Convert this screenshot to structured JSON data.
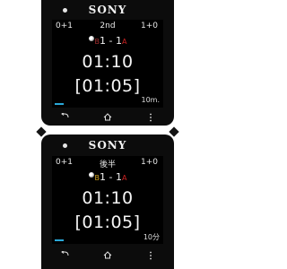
{
  "watches": [
    {
      "brand": "SONY",
      "score_left": "0+1",
      "period": "2nd",
      "score_right": "1+0",
      "team_left": "B",
      "team_left_score": "1",
      "separator": "-",
      "team_right_score": "1",
      "team_right": "A",
      "clock": "01:10",
      "clock_period": "[01:05]",
      "period_length": "10m.",
      "progress_percent": 12
    },
    {
      "brand": "SONY",
      "score_left": "0+1",
      "period": "後半",
      "score_right": "1+0",
      "team_left": "B",
      "team_left_score": "1",
      "separator": "-",
      "team_right_score": "1",
      "team_right": "A",
      "clock": "01:10",
      "clock_period": "[01:05]",
      "period_length": "10分",
      "progress_percent": 12
    }
  ],
  "nav": {
    "back_icon": "back-arrow-icon",
    "home_icon": "home-icon",
    "menu_icon": "overflow-menu-icon"
  },
  "colors": {
    "team_b": "#d4a520",
    "team_a": "#cc2222",
    "progress": "#2aa8d8"
  }
}
